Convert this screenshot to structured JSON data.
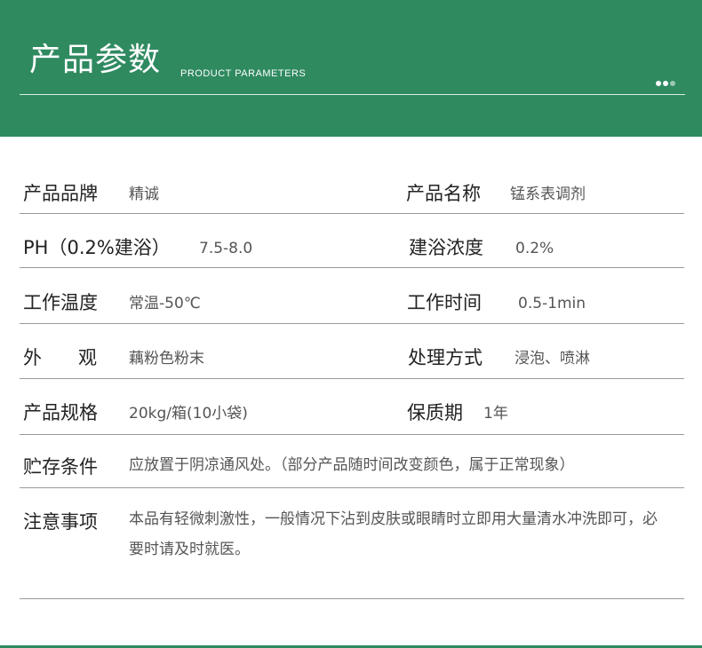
{
  "header": {
    "title": "产品参数",
    "subtitle": "PRODUCT PARAMETERS",
    "dots": [
      "on",
      "on",
      "off"
    ]
  },
  "params": {
    "brand_label": "产品品牌",
    "brand_value": "精诚",
    "name_label": "产品名称",
    "name_value": "锰系表调剂",
    "ph_label": "PH（0.2%建浴）",
    "ph_value": "7.5-8.0",
    "concentration_label": "建浴浓度",
    "concentration_value": "0.2%",
    "temp_label": "工作温度",
    "temp_value": "常温-50℃",
    "time_label": "工作时间",
    "time_value": "0.5-1min",
    "appearance_label": "外　观",
    "appearance_value": "藕粉色粉末",
    "method_label": "处理方式",
    "method_value": "浸泡、喷淋",
    "spec_label": "产品规格",
    "spec_value": "20kg/箱(10小袋)",
    "shelf_label": "保质期",
    "shelf_value": "1年",
    "storage_label": "贮存条件",
    "storage_value": "应放置于阴凉通风处。（部分产品随时间改变颜色，属于正常现象）",
    "notice_label": "注意事项",
    "notice_value": "本品有轻微刺激性，一般情况下沾到皮肤或眼睛时立即用大量清水冲洗即可，必要时请及时就医。"
  },
  "colors": {
    "brand_green": "#2f8a60",
    "rule_gray": "#9a9a9a"
  }
}
